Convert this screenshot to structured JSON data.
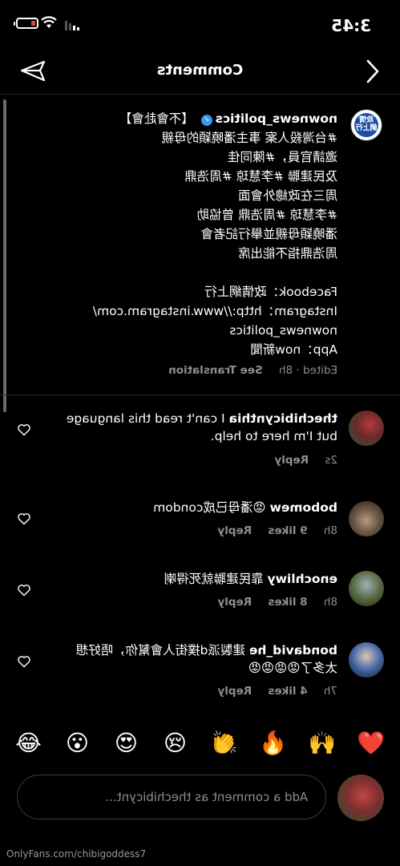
{
  "status_bar": {
    "time": "3:45"
  },
  "header": {
    "title": "Comments"
  },
  "caption": {
    "username": "nownews_politics",
    "text": "【不會赴會】\n#台灣殺人案 事主潘曉穎的母親\n邀請官員，#陳同佳\n及民建聯 #李慧琼 #周浩鼎\n周三在政總外會面\n#李慧琼 #周浩鼎 曾協助\n潘曉穎母親並舉行記者會\n周浩鼎指不能出席\n\nFacebook：政情網上行\nInstagram：http://www.instagram.com/\nnownews_politics\nApp：now新聞",
    "edited": "Edited · 8h",
    "see_translation": "See Translation"
  },
  "comments": [
    {
      "username": "thechibicynthia",
      "text": "I can't read this language but I'm here to help.",
      "time": "2s",
      "likes": "",
      "reply": "Reply"
    },
    {
      "username": "bobomew",
      "text": "😡潘母已成condom",
      "time": "8h",
      "likes": "9 likes",
      "reply": "Reply"
    },
    {
      "username": "enochliwy",
      "text": "靠民建聯就死得喇",
      "time": "8h",
      "likes": "8 likes",
      "reply": "Reply"
    },
    {
      "username": "bondavid_he",
      "text": "建製派d撲街人會幫你，唔好想太多了😡😡😡😡",
      "time": "7h",
      "likes": "4 likes",
      "reply": "Reply"
    }
  ],
  "emoji_bar": [
    "❤️",
    "🙌",
    "🔥",
    "👏",
    "😢",
    "😍",
    "😮",
    "😂"
  ],
  "composer": {
    "placeholder": "Add a comment as thechibicynt..."
  },
  "watermark": "OnlyFans.com/chibigoddess7",
  "icons": {
    "back": "chevron-left-icon",
    "share": "paper-plane-icon",
    "like": "heart-outline-icon"
  },
  "colors": {
    "background": "#000000",
    "muted_text": "#8e8e8e",
    "verified": "#3897f0",
    "divider": "#262626"
  }
}
